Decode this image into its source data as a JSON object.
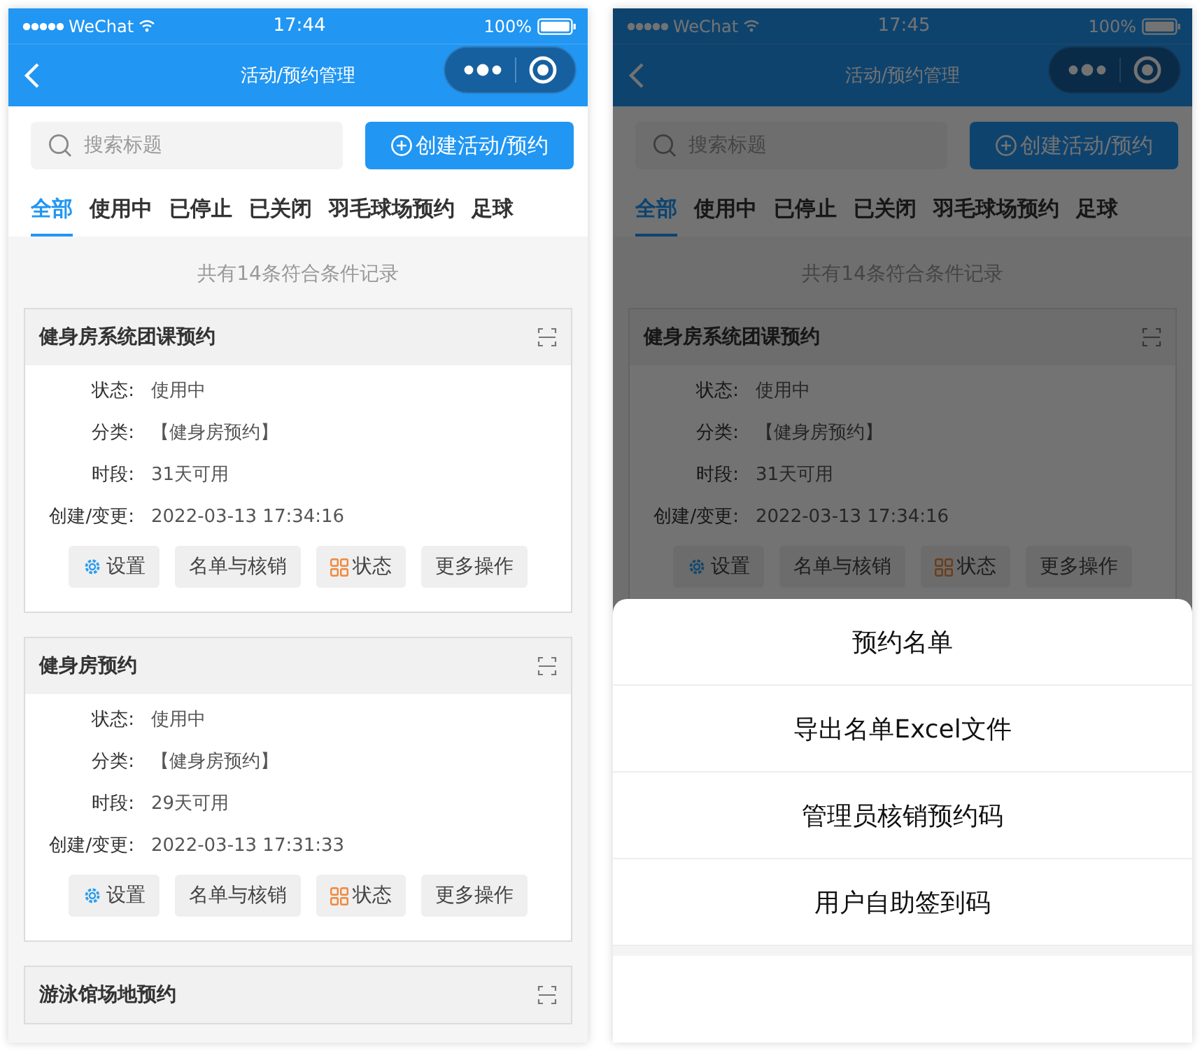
{
  "screens": [
    {
      "status_bar": {
        "carrier": "WeChat",
        "time": "17:44",
        "battery": "100%"
      },
      "nav_title": "活动/预约管理",
      "search": {
        "placeholder": "搜索标题"
      },
      "create_button": "创建活动/预约",
      "tabs": [
        {
          "label": "全部",
          "selected": true
        },
        {
          "label": "使用中",
          "selected": false
        },
        {
          "label": "已停止",
          "selected": false
        },
        {
          "label": "已关闭",
          "selected": false
        },
        {
          "label": "羽毛球场预约",
          "selected": false
        },
        {
          "label": "足球",
          "selected": false
        }
      ],
      "summary": "共有14条符合条件记录",
      "cards": [
        {
          "title": "健身房系统团课预约",
          "fields": [
            {
              "label": "状态:",
              "value": "使用中"
            },
            {
              "label": "分类:",
              "value": "【健身房预约】"
            },
            {
              "label": "时段:",
              "value": "31天可用"
            },
            {
              "label": "创建/变更:",
              "value": "2022-03-13 17:34:16"
            }
          ],
          "buttons": [
            {
              "label": "设置",
              "kind": "gear"
            },
            {
              "label": "名单与核销",
              "kind": "plain"
            },
            {
              "label": "状态",
              "kind": "grid"
            },
            {
              "label": "更多操作",
              "kind": "plain"
            }
          ]
        },
        {
          "title": "健身房预约",
          "fields": [
            {
              "label": "状态:",
              "value": "使用中"
            },
            {
              "label": "分类:",
              "value": "【健身房预约】"
            },
            {
              "label": "时段:",
              "value": "29天可用"
            },
            {
              "label": "创建/变更:",
              "value": "2022-03-13 17:31:33"
            }
          ],
          "buttons": [
            {
              "label": "设置",
              "kind": "gear"
            },
            {
              "label": "名单与核销",
              "kind": "plain"
            },
            {
              "label": "状态",
              "kind": "grid"
            },
            {
              "label": "更多操作",
              "kind": "plain"
            }
          ]
        },
        {
          "title": "游泳馆场地预约"
        }
      ]
    },
    {
      "status_bar": {
        "carrier": "WeChat",
        "time": "17:45",
        "battery": "100%"
      },
      "nav_title": "活动/预约管理",
      "search": {
        "placeholder": "搜索标题"
      },
      "create_button": "创建活动/预约",
      "tabs": [
        {
          "label": "全部",
          "selected": true
        },
        {
          "label": "使用中",
          "selected": false
        },
        {
          "label": "已停止",
          "selected": false
        },
        {
          "label": "已关闭",
          "selected": false
        },
        {
          "label": "羽毛球场预约",
          "selected": false
        },
        {
          "label": "足球",
          "selected": false
        }
      ],
      "summary": "共有14条符合条件记录",
      "cards": [
        {
          "title": "健身房系统团课预约",
          "fields": [
            {
              "label": "状态:",
              "value": "使用中"
            },
            {
              "label": "分类:",
              "value": "【健身房预约】"
            },
            {
              "label": "时段:",
              "value": "31天可用"
            },
            {
              "label": "创建/变更:",
              "value": "2022-03-13 17:34:16"
            }
          ],
          "buttons": [
            {
              "label": "设置",
              "kind": "gear"
            },
            {
              "label": "名单与核销",
              "kind": "plain"
            },
            {
              "label": "状态",
              "kind": "grid"
            },
            {
              "label": "更多操作",
              "kind": "plain"
            }
          ]
        }
      ],
      "action_sheet": [
        "预约名单",
        "导出名单Excel文件",
        "管理员核销预约码",
        "用户自助签到码"
      ]
    }
  ]
}
